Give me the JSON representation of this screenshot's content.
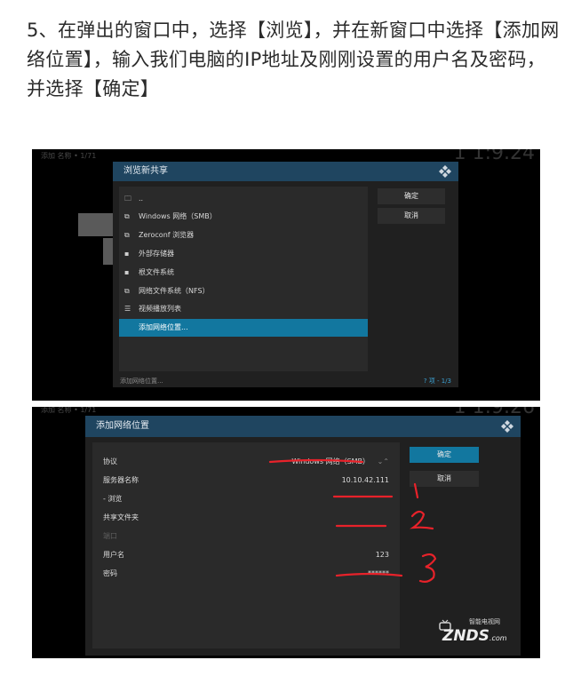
{
  "instruction": "5、在弹出的窗口中，选择【浏览】，并在新窗口中选择【添加网络位置】，输入我们电脑的IP地址及刚刚设置的用户名及密码，并选择【确定】",
  "shot1": {
    "bg_topleft": "添加 名称 • 1/71",
    "bg_clock": "1 1:9.24",
    "dialog_title": "浏览新共享",
    "items": [
      {
        "icon": "folder-up-icon",
        "glyph": "🗀",
        "label": ".."
      },
      {
        "icon": "network-share-icon",
        "glyph": "⧉",
        "label": "Windows 网络（SMB）"
      },
      {
        "icon": "network-share-icon",
        "glyph": "⧉",
        "label": "Zeroconf 浏览器"
      },
      {
        "icon": "drive-icon",
        "glyph": "▪",
        "label": "外部存储器"
      },
      {
        "icon": "drive-icon",
        "glyph": "▪",
        "label": "根文件系统"
      },
      {
        "icon": "network-share-icon",
        "glyph": "⧉",
        "label": "网络文件系统（NFS）"
      },
      {
        "icon": "playlist-icon",
        "glyph": "☰",
        "label": "视频播放列表"
      },
      {
        "icon": "",
        "glyph": "",
        "label": "添加网络位置..."
      }
    ],
    "selected_index": 7,
    "ok_label": "确定",
    "cancel_label": "取消",
    "footer_left": "添加网络位置...",
    "footer_right": "? 项 - 1/3"
  },
  "shot2": {
    "bg_topleft": "添加 名称 • 1/71",
    "bg_clock": "1 1:9.26",
    "dialog_title": "添加网络位置",
    "fields": [
      {
        "label": "协议",
        "value": "Windows 网络（SMB）"
      },
      {
        "label": "服务器名称",
        "value": "10.10.42.111"
      },
      {
        "label": "- 浏览",
        "value": ""
      },
      {
        "label": "共享文件夹",
        "value": ""
      },
      {
        "label": "端口",
        "value": ""
      },
      {
        "label": "用户名",
        "value": "123"
      },
      {
        "label": "密码",
        "value": "******"
      }
    ],
    "protocol_arrows": "⌄⌃",
    "ok_label": "确定",
    "cancel_label": "取消",
    "annotations": [
      "1",
      "2",
      "3"
    ],
    "annotation_color": "#e8222a",
    "watermark_top": "智能电视网",
    "watermark_main": "ZNDS",
    "watermark_suffix": ".com"
  },
  "colors": {
    "header": "#1f4560",
    "accent": "#12779f",
    "panel": "#202020"
  }
}
